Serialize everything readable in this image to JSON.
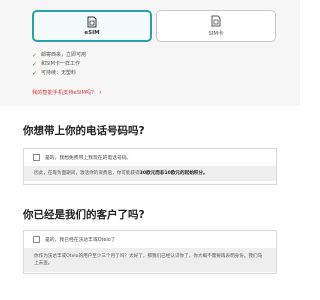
{
  "sim_selector": {
    "esim": {
      "label": "eSIM",
      "icon": "esim-card-icon",
      "selected": true
    },
    "sim": {
      "label": "SIM卡",
      "icon": "sim-card-icon",
      "selected": false
    },
    "accent_color": "#2aa0a8"
  },
  "features": [
    "邮寄西来，立即可用",
    "和SIM卡一样工作",
    "可持续：无塑料"
  ],
  "compat_link": "我的智能手机支持eSIM吗?",
  "keep_number": {
    "title": "你想带上你的电话号码吗?",
    "option_label": "是的，我想免费带上我现在的电话号码。",
    "info_prefix": "因此，在靠负面期间，激活你的资费后，你可能获得",
    "info_bold": "30欧元而非10欧元的起始积分。"
  },
  "existing_customer": {
    "title": "你已经是我们的客户了吗?",
    "option_label": "是的，我已经在沃达丰或Otelo了",
    "info_text": "你作为沃达丰或Otelo的用户至少三个月了吗？太好了，那我们已经认识你了。你大概不需要再表明身份。我们马上去查。"
  },
  "colors": {
    "link": "#d43b3b",
    "check": "#3ea03e"
  }
}
